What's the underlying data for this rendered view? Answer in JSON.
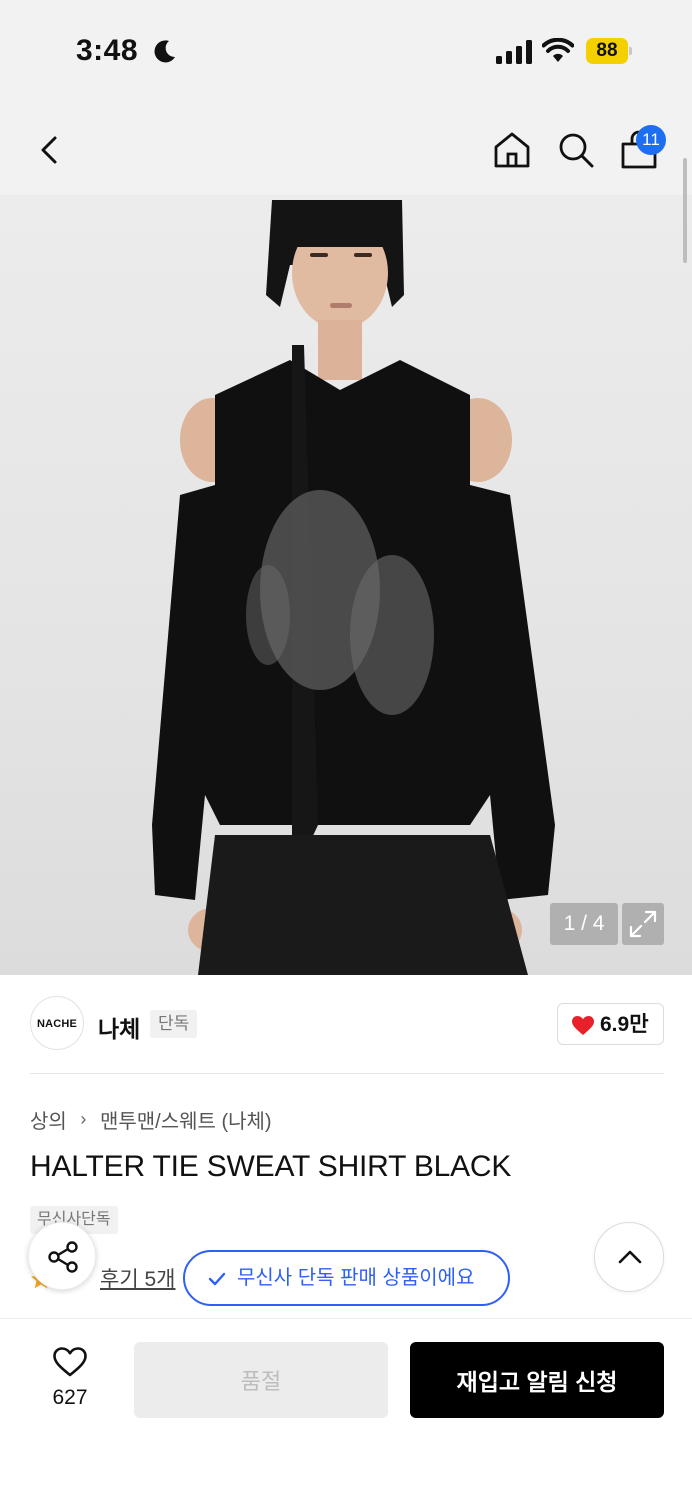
{
  "status_bar": {
    "time": "3:48",
    "battery": "88"
  },
  "nav": {
    "cart_count": "11",
    "icons": [
      "back-icon",
      "home-icon",
      "search-icon",
      "shopping-bag-icon"
    ]
  },
  "image": {
    "counter": "1 / 4"
  },
  "brand": {
    "logo_text": "NACHE",
    "name": "나체",
    "tag": "단독",
    "likes": "6.9만"
  },
  "product": {
    "breadcrumb": [
      "상의",
      "맨투맨/스웨트 (나체)"
    ],
    "title": "HALTER TIE SWEAT SHIRT BLACK",
    "tag": "무신사단독",
    "review_link": "후기 5개",
    "exclusive_notice": "무신사 단독 판매 상품이에요"
  },
  "bottom_bar": {
    "wish_count": "627",
    "soldout_label": "품절",
    "restock_label": "재입고 알림 신청"
  },
  "colors": {
    "accent_blue": "#2f5ff5",
    "badge_blue": "#1d6ff0",
    "heart_red": "#e8202a",
    "battery_yellow": "#f5d000"
  }
}
